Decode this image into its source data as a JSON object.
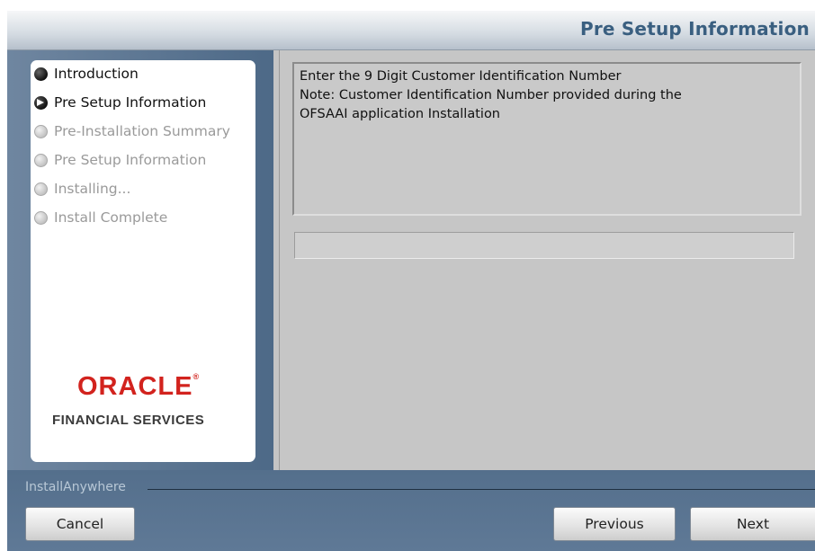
{
  "header": {
    "title": "Pre Setup Information"
  },
  "steps": [
    {
      "label": "Introduction",
      "state": "done"
    },
    {
      "label": "Pre Setup Information",
      "state": "current"
    },
    {
      "label": "Pre-Installation Summary",
      "state": "pending"
    },
    {
      "label": "Pre Setup Information",
      "state": "pending"
    },
    {
      "label": "Installing...",
      "state": "pending"
    },
    {
      "label": "Install Complete",
      "state": "pending"
    }
  ],
  "branding": {
    "logo_text": "ORACLE",
    "subtitle": "FINANCIAL SERVICES"
  },
  "content": {
    "lines": [
      "Enter the 9 Digit Customer Identification Number",
      "Note: Customer Identification Number provided during the",
      "OFSAAI application Installation"
    ],
    "input_value": ""
  },
  "footer": {
    "vendor_label": "InstallAnywhere",
    "cancel_label": "Cancel",
    "previous_label": "Previous",
    "next_label": "Next"
  },
  "colors": {
    "header_title": "#3a5f80",
    "oracle_red": "#d2231e",
    "sidebar_blue": "#5a7592"
  }
}
